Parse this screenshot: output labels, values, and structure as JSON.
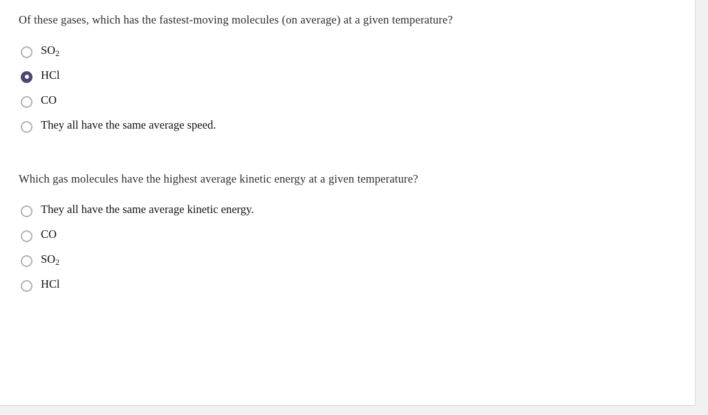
{
  "page": {
    "background_color": "#f1f1f1",
    "pane_color": "#ffffff",
    "divider_color": "#dcdcdc",
    "selected_radio_color": "#4d4672",
    "unselected_radio_color": "#b4b4b4"
  },
  "questions": [
    {
      "id": "question-1",
      "text": "Of these gases, which has the fastest-moving molecules (on average) at a given temperature?",
      "options": [
        {
          "label": "SO2",
          "base": "SO",
          "sub": "2",
          "selected": false
        },
        {
          "label": "HCl",
          "base": "HCl",
          "sub": "",
          "selected": true
        },
        {
          "label": "CO",
          "base": "CO",
          "sub": "",
          "selected": false
        },
        {
          "label": "They all have the same average speed.",
          "base": "They all have the same average speed.",
          "sub": "",
          "selected": false
        }
      ]
    },
    {
      "id": "question-2",
      "text": "Which gas molecules have the highest average kinetic energy at a given temperature?",
      "options": [
        {
          "label": "They all have the same average kinetic energy.",
          "base": "They all have the same average kinetic energy.",
          "sub": "",
          "selected": false
        },
        {
          "label": "CO",
          "base": "CO",
          "sub": "",
          "selected": false
        },
        {
          "label": "SO2",
          "base": "SO",
          "sub": "2",
          "selected": false
        },
        {
          "label": "HCl",
          "base": "HCl",
          "sub": "",
          "selected": false
        }
      ]
    }
  ]
}
